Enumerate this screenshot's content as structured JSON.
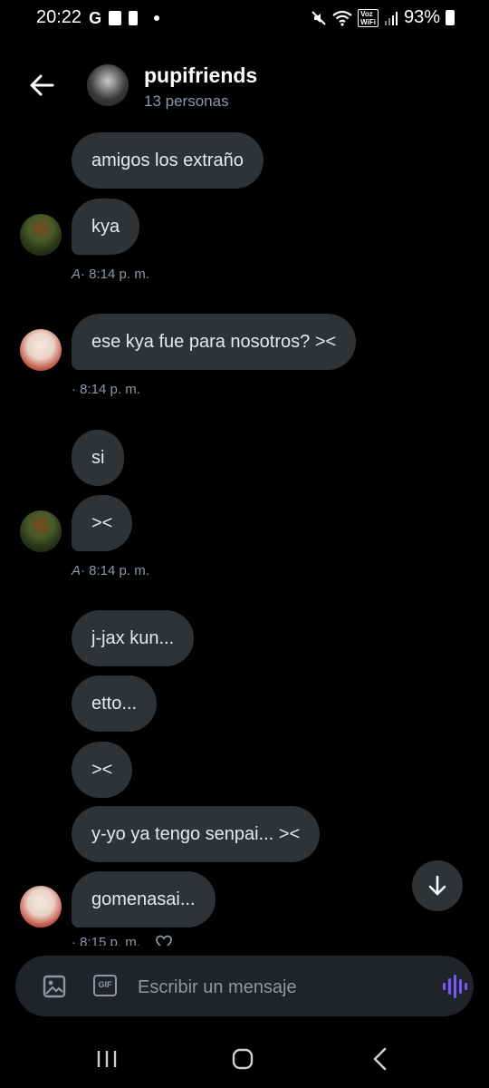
{
  "status_bar": {
    "time": "20:22",
    "left_icons": [
      "G",
      "check-icon",
      "sim-icon"
    ],
    "voz_label": "Voz\nWiFi",
    "battery": "93%"
  },
  "header": {
    "group_name": "pupifriends",
    "members": "13 personas"
  },
  "messages": [
    {
      "text": "amigos los extraño"
    },
    {
      "text": "kya"
    },
    {
      "text": "ese kya fue para nosotros? ><"
    },
    {
      "text": "si"
    },
    {
      "text": "><"
    },
    {
      "text": "j-jax kun..."
    },
    {
      "text": "etto..."
    },
    {
      "text": "><"
    },
    {
      "text": "y-yo ya tengo senpai... ><"
    },
    {
      "text": "gomenasai..."
    }
  ],
  "timestamps": [
    {
      "time": "8:14 p. m."
    },
    {
      "time": "8:14 p. m."
    },
    {
      "time": "8:14 p. m."
    },
    {
      "time": "8:15 p. m."
    }
  ],
  "composer": {
    "placeholder": "Escribir un mensaje",
    "gif_label": "GIF"
  },
  "colors": {
    "background": "#000000",
    "bubble": "#2f3336",
    "secondary_text": "#8b98a5",
    "voice_accent": "#7856ff"
  }
}
